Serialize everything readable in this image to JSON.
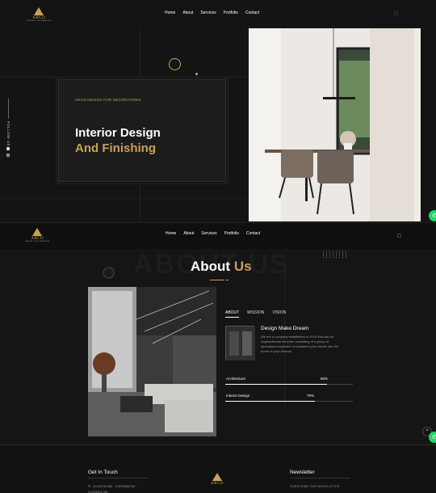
{
  "brand": {
    "name": "ARCO",
    "tagline": "DESIGN & DECORATIONS"
  },
  "nav": [
    "Home",
    "About",
    "Services",
    "Portfolio",
    "Contact"
  ],
  "hero": {
    "kicker": "ARCO DESIGN FOR DECORATIONS",
    "title_line1": "Interior Design",
    "title_line2": "And Finishing",
    "follow_label": "FOLLOW US"
  },
  "about": {
    "bg_text": "ABOUT US",
    "title_word1": "About",
    "title_word2": "Us",
    "tabs": [
      "ABOUT",
      "MISSION",
      "VISION"
    ],
    "card_title": "Design Make Dream",
    "card_text": "We are a company established in 2019 that has an organizational structure consisting of a group of specialized engineers to transform your needs into the home of your dreams.",
    "skills": [
      {
        "label": "Architecture",
        "value_text": "80%",
        "value": 80
      },
      {
        "label": "Interior Design",
        "value_text": "70%",
        "value": 70
      }
    ]
  },
  "footer": {
    "get_in_touch": "Get In Touch",
    "phone": "01140742480 - 01093566706 -",
    "phone2": "01093351706",
    "newsletter": "Newsletter",
    "subscribe": "SUBSCRIBE OUR NEWSLETTER"
  },
  "colors": {
    "accent": "#c9a15c",
    "background": "#111111",
    "whatsapp": "#25d366"
  }
}
